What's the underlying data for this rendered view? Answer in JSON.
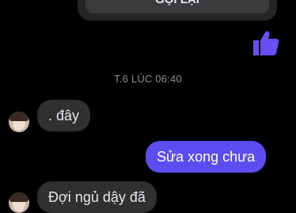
{
  "call_card": {
    "call_back_label": "GỌI LẠI"
  },
  "like_icon": "thumbs-up-icon",
  "timestamp": "T.6 LÚC 06:40",
  "messages": [
    {
      "direction": "incoming",
      "text": ". đây"
    },
    {
      "direction": "outgoing",
      "text": "Sửa xong chưa"
    },
    {
      "direction": "incoming",
      "text": "Đợi ngủ dậy đã"
    }
  ],
  "colors": {
    "background": "#000000",
    "incoming_bubble": "#303030",
    "outgoing_bubble": "#5b4df0",
    "like": "#6b4ef2"
  }
}
